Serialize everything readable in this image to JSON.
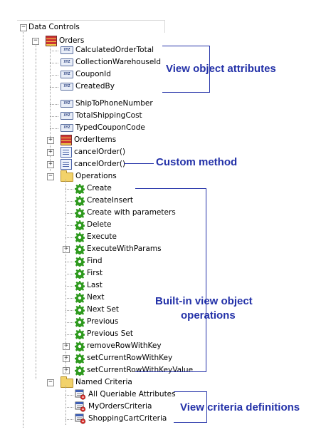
{
  "tree": {
    "root": {
      "label": "Data Controls"
    },
    "orders": {
      "label": "Orders"
    },
    "attributes_a": [
      {
        "label": "CalculatedOrderTotal",
        "badge": "XYZ"
      },
      {
        "label": "CollectionWarehouseId",
        "badge": "XYZ"
      },
      {
        "label": "CouponId",
        "badge": "XYZ"
      },
      {
        "label": "CreatedBy",
        "badge": "XYZ"
      }
    ],
    "attributes_b": [
      {
        "label": "ShipToPhoneNumber",
        "badge": "XYZ"
      },
      {
        "label": "TotalShippingCost",
        "badge": "XYZ"
      },
      {
        "label": "TypedCouponCode",
        "badge": "XYZ"
      }
    ],
    "order_items": {
      "label": "OrderItems"
    },
    "methods": [
      {
        "label": "cancelOrder()"
      },
      {
        "label": "cancelOrder()"
      }
    ],
    "operations": {
      "label": "Operations"
    },
    "operation_items": [
      {
        "label": "Create",
        "expandable": false
      },
      {
        "label": "CreateInsert",
        "expandable": false
      },
      {
        "label": "Create with parameters",
        "expandable": false
      },
      {
        "label": "Delete",
        "expandable": false
      },
      {
        "label": "Execute",
        "expandable": false
      },
      {
        "label": "ExecuteWithParams",
        "expandable": true
      },
      {
        "label": "Find",
        "expandable": false
      },
      {
        "label": "First",
        "expandable": false
      },
      {
        "label": "Last",
        "expandable": false
      },
      {
        "label": "Next",
        "expandable": false
      },
      {
        "label": "Next Set",
        "expandable": false
      },
      {
        "label": "Previous",
        "expandable": false
      },
      {
        "label": "Previous Set",
        "expandable": false
      },
      {
        "label": "removeRowWithKey",
        "expandable": true
      },
      {
        "label": "setCurrentRowWithKey",
        "expandable": true
      },
      {
        "label": "setCurrentRowWithKeyValue",
        "expandable": true
      }
    ],
    "named_criteria": {
      "label": "Named Criteria"
    },
    "criteria_items": [
      {
        "label": "All Queriable Attributes"
      },
      {
        "label": "MyOrdersCriteria"
      },
      {
        "label": "ShoppingCartCriteria"
      }
    ]
  },
  "annotations": {
    "view_object_attributes": "View object attributes",
    "custom_method": "Custom method",
    "builtin_ops_line1": "Built-in view object",
    "builtin_ops_line2": "operations",
    "view_criteria": "View criteria definitions"
  },
  "colors": {
    "annotation": "#2331a8",
    "gear": "#2e9a1e"
  }
}
